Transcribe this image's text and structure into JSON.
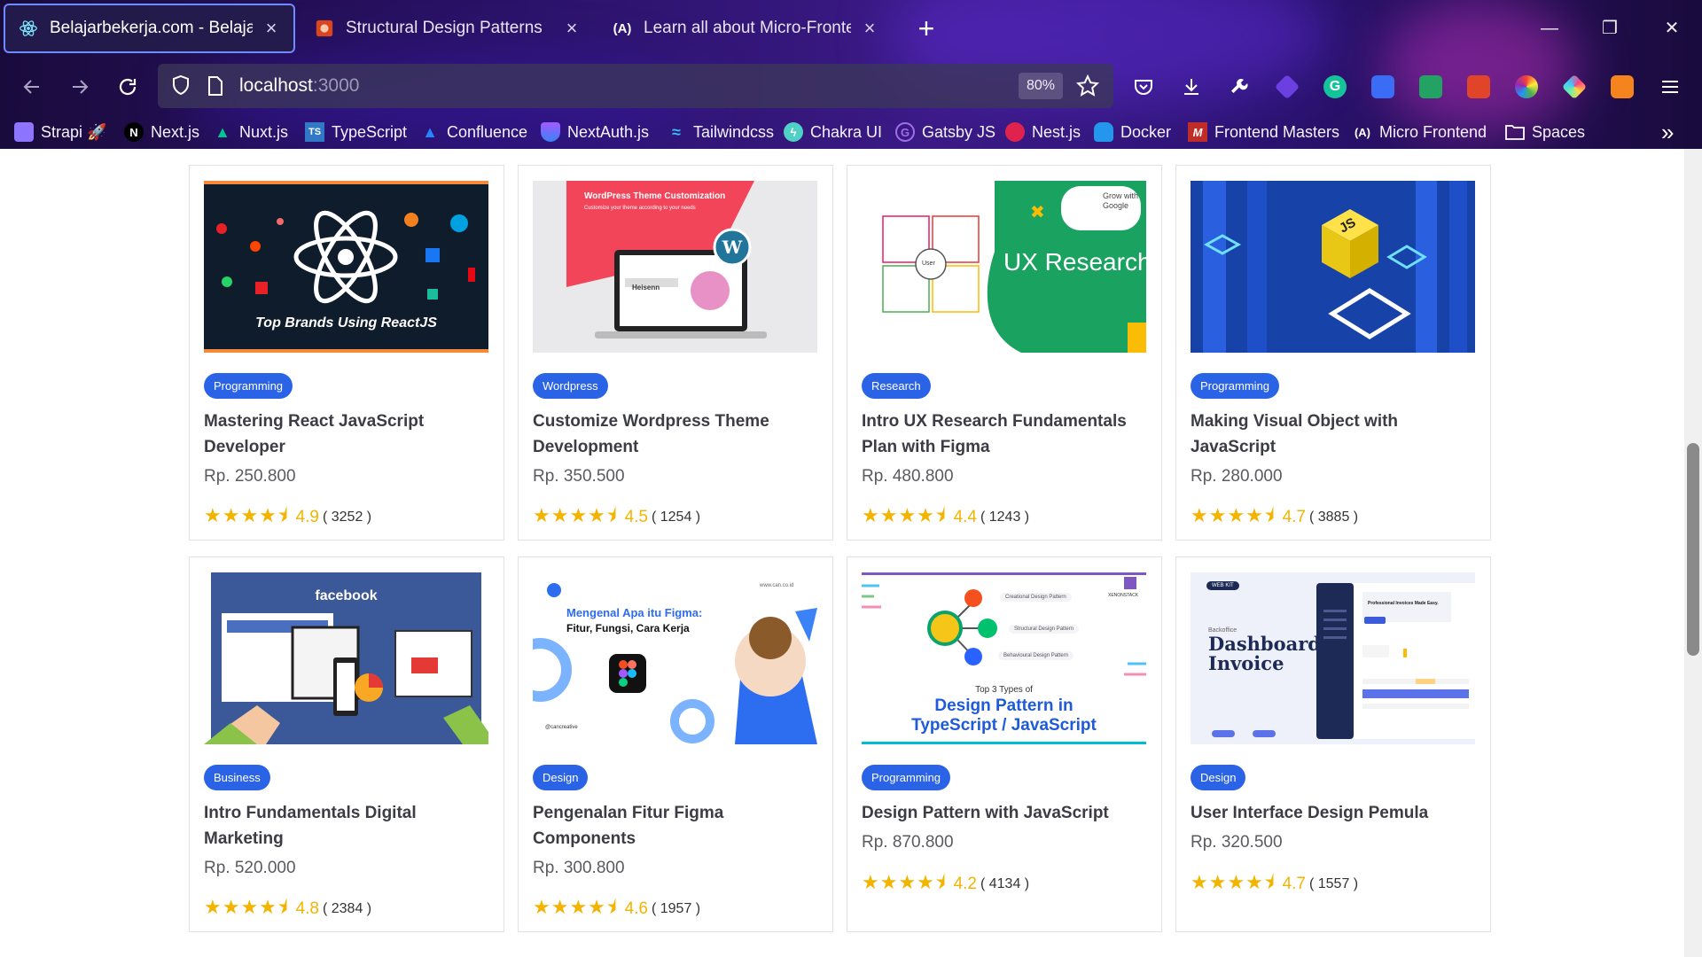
{
  "browser": {
    "tabs": [
      {
        "title": "Belajarbekerja.com - Belajar dengan Mentor",
        "active": true,
        "icon": "react-icon"
      },
      {
        "title": "Structural Design Patterns",
        "active": false,
        "icon": "structural-favicon-icon"
      },
      {
        "title": "Learn all about Micro-Frontends",
        "active": false,
        "icon": "micro-frontend-icon"
      }
    ],
    "new_tab_label": "+",
    "close_glyph": "×",
    "url_host": "localhost",
    "url_port": ":3000",
    "zoom": "80%",
    "bookmarks": [
      {
        "label": "Strapi 🚀",
        "icon": "strapi-icon",
        "color": "#8e75ff"
      },
      {
        "label": "Next.js",
        "icon": "nextjs-icon",
        "color": "#000000"
      },
      {
        "label": "Nuxt.js",
        "icon": "nuxt-icon",
        "color": "#00c58e"
      },
      {
        "label": "TypeScript",
        "icon": "typescript-icon",
        "color": "#3178c6"
      },
      {
        "label": "Confluence",
        "icon": "confluence-icon",
        "color": "#2684ff"
      },
      {
        "label": "NextAuth.js",
        "icon": "nextauth-icon",
        "color": "#a259ff"
      },
      {
        "label": "Tailwindcss",
        "icon": "tailwind-icon",
        "color": "#38bdf8"
      },
      {
        "label": "Chakra UI",
        "icon": "chakra-icon",
        "color": "#4fd1c5"
      },
      {
        "label": "Gatsby JS",
        "icon": "gatsby-icon",
        "color": "#a16ee8"
      },
      {
        "label": "Nest.js",
        "icon": "nestjs-icon",
        "color": "#e0234e"
      },
      {
        "label": "Docker",
        "icon": "docker-icon",
        "color": "#2496ed"
      },
      {
        "label": "Frontend Masters",
        "icon": "frontend-masters-icon",
        "color": "#c02d28"
      },
      {
        "label": "Micro Frontend",
        "icon": "micro-frontend-icon",
        "color": "#ffffff"
      },
      {
        "label": "Spaces",
        "icon": "folder-icon",
        "color": "#ffffff"
      }
    ],
    "more_bookmarks": "»"
  },
  "courses": [
    {
      "category": "Programming",
      "title": "Mastering React JavaScript Developer",
      "price": "Rp. 250.800",
      "rating": "4.9",
      "count": "( 3252 )",
      "thumb_text": "Top Brands Using ReactJS"
    },
    {
      "category": "Wordpress",
      "title": "Customize Wordpress Theme Development",
      "price": "Rp. 350.500",
      "rating": "4.5",
      "count": "( 1254 )",
      "thumb_text": "WordPress Theme Customization",
      "thumb_sub": "Customize your theme according to your needs",
      "thumb_brand": "Heisenn"
    },
    {
      "category": "Research",
      "title": "Intro UX Research Fundamentals Plan with Figma",
      "price": "Rp. 480.800",
      "rating": "4.4",
      "count": "( 1243 )",
      "thumb_text": "UX Research",
      "thumb_sub": "Grow with Google",
      "thumb_center": "User"
    },
    {
      "category": "Programming",
      "title": "Making Visual Object with JavaScript",
      "price": "Rp. 280.000",
      "rating": "4.7",
      "count": "( 3885 )",
      "thumb_text": "JS"
    },
    {
      "category": "Business",
      "title": "Intro Fundamentals Digital Marketing",
      "price": "Rp. 520.000",
      "rating": "4.8",
      "count": "( 2384 )",
      "thumb_text": "facebook"
    },
    {
      "category": "Design",
      "title": "Pengenalan Fitur Figma Components",
      "price": "Rp. 300.800",
      "rating": "4.6",
      "count": "( 1957 )",
      "thumb_text": "Mengenal Apa itu Figma:",
      "thumb_sub": "Fitur, Fungsi, Cara Kerja",
      "thumb_brand": "@cancreative",
      "thumb_url": "www.can.co.id"
    },
    {
      "category": "Programming",
      "title": "Design Pattern with JavaScript",
      "price": "Rp. 870.800",
      "rating": "4.2",
      "count": "( 4134 )",
      "thumb_text": "Design Pattern in",
      "thumb_sub": "TypeScript / JavaScript",
      "thumb_small": "Top 3 Types of",
      "thumb_brand": "XENONSTACK",
      "thumb_items": [
        "Creational Design Pattern",
        "Structural Design Pattern",
        "Behavioural Design Pattern"
      ]
    },
    {
      "category": "Design",
      "title": "User Interface Design Pemula",
      "price": "Rp. 320.500",
      "rating": "4.7",
      "count": "( 1557 )",
      "thumb_text": "Dashboard Invoice",
      "thumb_small": "Backoffice",
      "thumb_sub": "Professional Invoices Made Easy.",
      "thumb_brand": "WEB KIT"
    }
  ],
  "colors": {
    "badge": "#2b63e6",
    "star": "#f3b400",
    "title": "#3c3c45",
    "price": "#5a5a60"
  }
}
